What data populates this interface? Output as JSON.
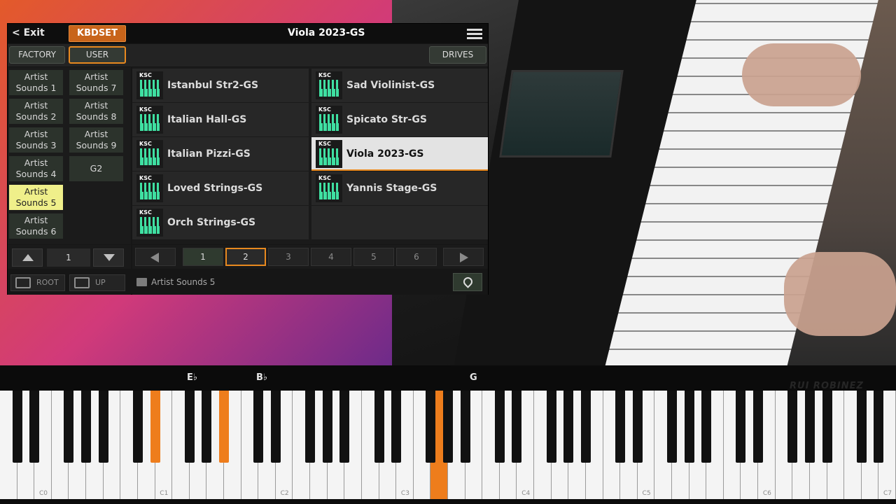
{
  "window": {
    "exit_label": "< Exit",
    "kbdset_label": "KBDSET",
    "title": "Viola 2023-GS"
  },
  "tabs": {
    "factory": "FACTORY",
    "user": "USER",
    "drives": "DRIVES"
  },
  "sidebar": {
    "items": [
      {
        "l1": "Artist",
        "l2": "Sounds 1"
      },
      {
        "l1": "Artist",
        "l2": "Sounds 7"
      },
      {
        "l1": "Artist",
        "l2": "Sounds 2"
      },
      {
        "l1": "Artist",
        "l2": "Sounds 8"
      },
      {
        "l1": "Artist",
        "l2": "Sounds 3"
      },
      {
        "l1": "Artist",
        "l2": "Sounds 9"
      },
      {
        "l1": "Artist",
        "l2": "Sounds 4"
      },
      {
        "l1": "G2",
        "l2": ""
      },
      {
        "l1": "Artist",
        "l2": "Sounds 5"
      },
      {
        "l1": "Artist",
        "l2": "Sounds 6"
      }
    ],
    "selected": "Artist Sounds 5",
    "page": "1",
    "root_label": "ROOT",
    "up_label": "UP"
  },
  "sounds": {
    "tag": "KSC",
    "items": [
      "Istanbul Str2-GS",
      "Sad Violinist-GS",
      "Italian Hall-GS",
      "Spicato Str-GS",
      "Italian Pizzi-GS",
      "Viola 2023-GS",
      "Loved Strings-GS",
      "Yannis Stage-GS",
      "Orch Strings-GS"
    ],
    "selected": "Viola 2023-GS"
  },
  "pager": {
    "pages": [
      "1",
      "2",
      "3",
      "4",
      "5",
      "6"
    ],
    "current": "2"
  },
  "path": {
    "folder": "Artist Sounds 5"
  },
  "piano": {
    "note_labels": [
      "E♭",
      "B♭",
      "G"
    ],
    "octave_labels": [
      "C0",
      "C1",
      "C2",
      "C3",
      "C4",
      "C5",
      "C6",
      "C7"
    ],
    "highlighted_notes": [
      "E♭1",
      "B♭1",
      "G3"
    ],
    "highlight_color": "#ee7d1c",
    "watermark": "RUI ROBINEZ"
  },
  "colors": {
    "accent": "#e8891f",
    "selected_folder": "#efef8a",
    "ksc_icon": "#3fe0a2"
  }
}
